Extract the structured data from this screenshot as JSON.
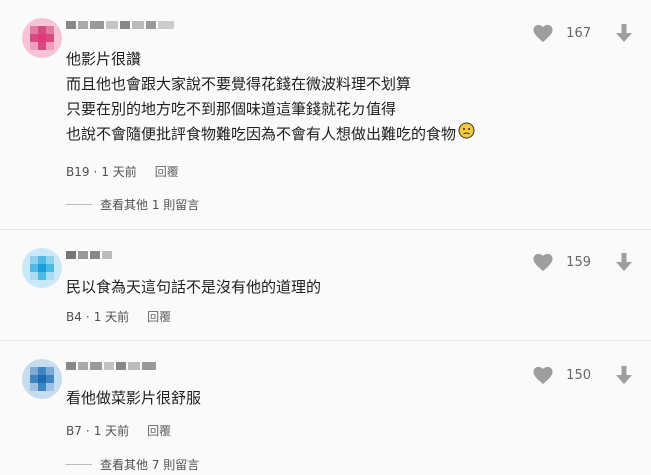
{
  "comments": [
    {
      "avatar_color": "#e54b7e",
      "lines": [
        "他影片很讚",
        "而且他也會跟大家說不要覺得花錢在微波料理不划算",
        "只要在別的地方吃不到那個味道這筆錢就花ㄉ值得",
        "也說不會隨便批評食物難吃因為不會有人想做出難吃的食物"
      ],
      "emoji_icon": "confused-face-icon",
      "user_id": "B19",
      "time": "1 天前",
      "reply_label": "回覆",
      "likes": "167",
      "more_replies": "查看其他 1 則留言"
    },
    {
      "avatar_color": "#27aae1",
      "lines": [
        "民以食為天這句話不是沒有他的道理的"
      ],
      "user_id": "B4",
      "time": "1 天前",
      "reply_label": "回覆",
      "likes": "159"
    },
    {
      "avatar_color": "#2f7fbf",
      "lines": [
        "看他做菜影片很舒服"
      ],
      "user_id": "B7",
      "time": "1 天前",
      "reply_label": "回覆",
      "likes": "150",
      "more_replies": "查看其他 7 則留言"
    }
  ],
  "separator": "·"
}
